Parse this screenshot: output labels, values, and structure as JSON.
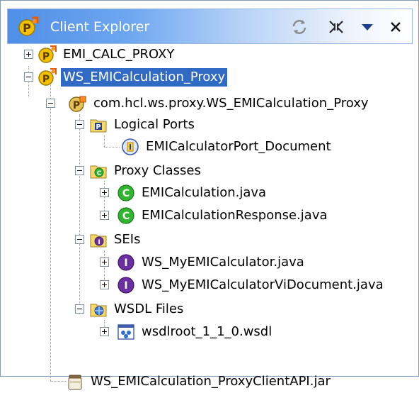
{
  "view": {
    "title": "Client Explorer"
  },
  "toolbar": {
    "sync_icon": "sync-icon",
    "collapse_icon": "collapse-all-icon",
    "menu_icon": "view-menu-icon",
    "close_icon": "close-icon"
  },
  "tree": {
    "emi_calc_proxy": "EMI_CALC_PROXY",
    "ws_proxy": "WS_EMICalculation_Proxy",
    "package": "com.hcl.ws.proxy.WS_EMICalculation_Proxy",
    "logical_ports": "Logical Ports",
    "port_document": "EMICalculatorPort_Document",
    "proxy_classes": "Proxy Classes",
    "emi_calculation": "EMICalculation.java",
    "emi_calculation_response": "EMICalculationResponse.java",
    "seis": "SEIs",
    "my_emi_calculator": "WS_MyEMICalculator.java",
    "my_emi_calculator_vi": "WS_MyEMICalculatorViDocument.java",
    "wsdl_files": "WSDL Files",
    "wsdlroot": "wsdlroot_1_1_0.wsdl",
    "client_jar": "WS_EMICalculation_ProxyClientAPI.jar"
  },
  "colors": {
    "selection": "#316ac5",
    "title_start": "#4f8fe7",
    "class_icon": "#2fb52f",
    "interface_icon": "#6a2fa0"
  }
}
